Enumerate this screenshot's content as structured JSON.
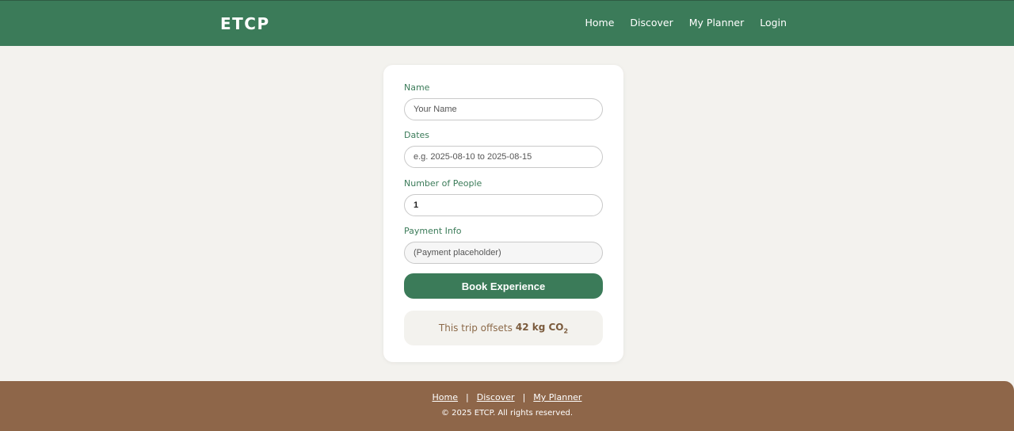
{
  "header": {
    "brand": "ETCP",
    "nav": [
      "Home",
      "Discover",
      "My Planner",
      "Login"
    ]
  },
  "form": {
    "name_label": "Name",
    "name_placeholder": "Your Name",
    "dates_label": "Dates",
    "dates_placeholder": "e.g. 2025-08-10 to 2025-08-15",
    "people_label": "Number of People",
    "people_value": "1",
    "payment_label": "Payment Info",
    "payment_placeholder": "(Payment placeholder)",
    "book_button": "Book Experience",
    "offset_prefix": "This trip offsets",
    "offset_amount": "42 kg CO",
    "offset_sub": "2"
  },
  "footer": {
    "links": [
      "Home",
      "Discover",
      "My Planner"
    ],
    "separator": "|",
    "copyright": "© 2025 ETCP. All rights reserved."
  },
  "colors": {
    "primary": "#3b7b59",
    "footer": "#8e6649",
    "background": "#f3f2ee"
  }
}
